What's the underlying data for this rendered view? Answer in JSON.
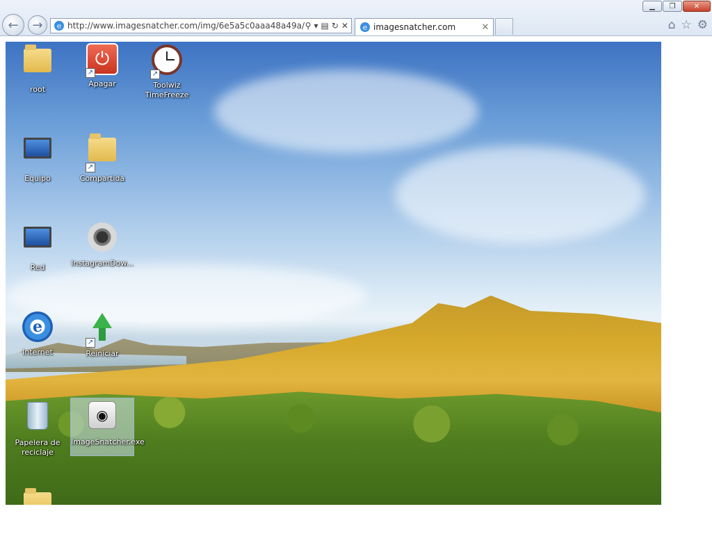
{
  "browser": {
    "address_url": "http://www.imagesnatcher.com/img/6e5a5c0aaa48a49a/",
    "tab_title": "imagesnatcher.com",
    "window_buttons": [
      "minimize",
      "restore",
      "close"
    ],
    "toolbar_icons": [
      "home-icon",
      "star-icon",
      "gear-icon"
    ]
  },
  "desktop_icons": [
    {
      "label": "root"
    },
    {
      "label": "Apagar"
    },
    {
      "label": "Toolwiz TimeFreeze"
    },
    {
      "label": "Equipo"
    },
    {
      "label": "Compartida"
    },
    {
      "label": "Red"
    },
    {
      "label": "InstagramDow..."
    },
    {
      "label": "Internet"
    },
    {
      "label": "Reiniciar"
    },
    {
      "label": "Papelera de reciclaje"
    },
    {
      "label": "ImageSnatcher.exe"
    }
  ],
  "colors": {
    "chrome_bg": "#dde7f3",
    "sky": "#6c9fd8",
    "dune": "#d6a92b",
    "shrub": "#4f7d1e"
  }
}
